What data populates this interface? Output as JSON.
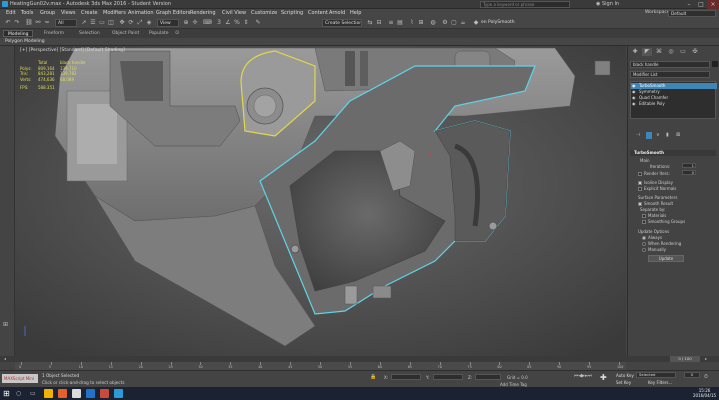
{
  "app": {
    "title": "HeatingGun02v.max - Autodesk 3ds Max 2016 - Student Version",
    "search_placeholder": "Type a keyword or phrase",
    "sign_in": "Sign In",
    "workspace_label": "Workspace:",
    "workspace_value": "Default"
  },
  "menu": [
    "Edit",
    "Tools",
    "Group",
    "Views",
    "Create",
    "Modifiers",
    "Animation",
    "Graph Editors",
    "Rendering",
    "Civil View",
    "Customize",
    "Scripting",
    "Content",
    "Arnold",
    "Help"
  ],
  "toolbar": {
    "selection_filter": "All",
    "view_dropdown": "View",
    "named_selection": "Create Selection Se",
    "polysmooth": "en PolySmooth"
  },
  "ribbon": {
    "tabs": [
      "Modeling",
      "Freeform",
      "Selection",
      "Object Paint",
      "Populate"
    ],
    "active_tab": "Modeling",
    "panel": "Polygon Modeling"
  },
  "viewport": {
    "label": "[+] [Perspective] [Standard] [Default Shading]",
    "stats": {
      "headers": [
        "Total",
        "black handle"
      ],
      "rows": [
        {
          "label": "Polys:",
          "total": "809,164",
          "sel": "139,710"
        },
        {
          "label": "Tris:",
          "total": "843,281",
          "sel": "139,782"
        },
        {
          "label": "Verts:",
          "total": "474,636",
          "sel": "68,089"
        }
      ],
      "fps_label": "FPS:",
      "fps_value": "588.351"
    }
  },
  "command_panel": {
    "object_name": "black handle",
    "modifier_list": "Modifier List",
    "stack": [
      {
        "label": "TurboSmooth",
        "selected": true
      },
      {
        "label": "Symmetry",
        "selected": false
      },
      {
        "label": "Quad Chamfer",
        "selected": false
      },
      {
        "label": "Editable Poly",
        "selected": false
      }
    ],
    "rollout": {
      "title": "TurboSmooth",
      "main_label": "Main",
      "iterations_label": "Iterations:",
      "iterations_value": "1",
      "render_iters_label": "Render Iters:",
      "render_iters_value": "0",
      "isoline_display": "Isoline Display",
      "explicit_normals": "Explicit Normals",
      "surface_params": "Surface Parameters",
      "smooth_result": "Smooth Result",
      "separate_by": "Separate by:",
      "materials": "Materials",
      "smoothing_groups": "Smoothing Groups",
      "update_options": "Update Options",
      "always": "Always",
      "when_rendering": "When Rendering",
      "manually": "Manually",
      "update_button": "Update"
    }
  },
  "timeline": {
    "frame_counter": "0 / 100",
    "ticks": [
      "0",
      "5",
      "10",
      "15",
      "20",
      "25",
      "30",
      "35",
      "40",
      "45",
      "50",
      "55",
      "60",
      "65",
      "70",
      "75",
      "80",
      "85",
      "90",
      "95",
      "100"
    ]
  },
  "status": {
    "maxscript": "MAXScript Mini",
    "selected": "1 Object Selected",
    "prompt": "Click or click-and-drag to select objects",
    "x_label": "X:",
    "y_label": "Y:",
    "z_label": "Z:",
    "grid": "Grid = 0.0",
    "add_time_tag": "Add Time Tag",
    "auto_key": "Auto Key",
    "set_key": "Set Key",
    "selected_dropdown": "Selected",
    "key_filters": "Key Filters...",
    "frame_value": "0"
  },
  "taskbar": {
    "time": "15:26",
    "date": "2016/04/15"
  },
  "colors": {
    "selection_outline": "#5fd4e8",
    "selected_yellow": "#e2d84a",
    "accent_blue": "#3f86b8",
    "model_gray": "#8a8a8a"
  }
}
